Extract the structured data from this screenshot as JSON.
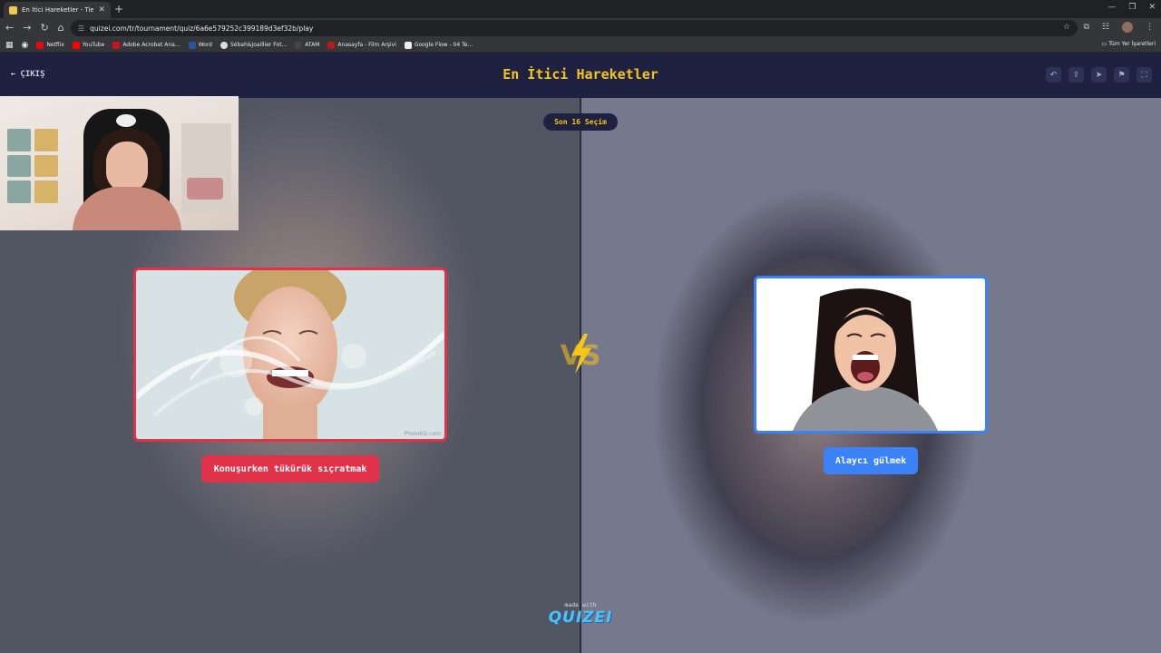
{
  "browser": {
    "tab_title": "En İtici Hareketler - Tier List, Kö",
    "tab_close": "✕",
    "new_tab": "+",
    "url": "quizei.com/tr/tournament/quiz/6a6e579252c399189d3ef32b/play",
    "bookmarks": [
      {
        "label": "Netflix",
        "color": "#e50914"
      },
      {
        "label": "YouTube",
        "color": "#ff0000"
      },
      {
        "label": "Adobe Acrobat Ana...",
        "color": "#c4161c"
      },
      {
        "label": "Word",
        "color": "#2b579a"
      },
      {
        "label": "Sébah&Joaillier Fot...",
        "color": "#dddddd"
      },
      {
        "label": "ATAM",
        "color": "#444444"
      },
      {
        "label": "Anasayfa - Film Arşivi",
        "color": "#b71c1c"
      },
      {
        "label": "Google Flow - 04 Te...",
        "color": "#eeeeee"
      }
    ],
    "all_bookmarks": "Tüm Yer İşaretleri"
  },
  "header": {
    "exit_label": "ÇIKIŞ",
    "title": "En İtici Hareketler",
    "title_color": "#f5c518",
    "icons": [
      "undo-icon",
      "share-icon",
      "send-icon",
      "flag-icon",
      "fullscreen-icon"
    ]
  },
  "round_badge": "Son 16 Seçim",
  "left_choice": {
    "label": "Konuşurken tükürük sıçratmak",
    "color": "#e0334a",
    "watermark": "PhotoKG.com"
  },
  "right_choice": {
    "label": "Alaycı gülmek",
    "color": "#3b82f6"
  },
  "footer": {
    "made_with": "made with",
    "logo": "QUIZEI"
  }
}
